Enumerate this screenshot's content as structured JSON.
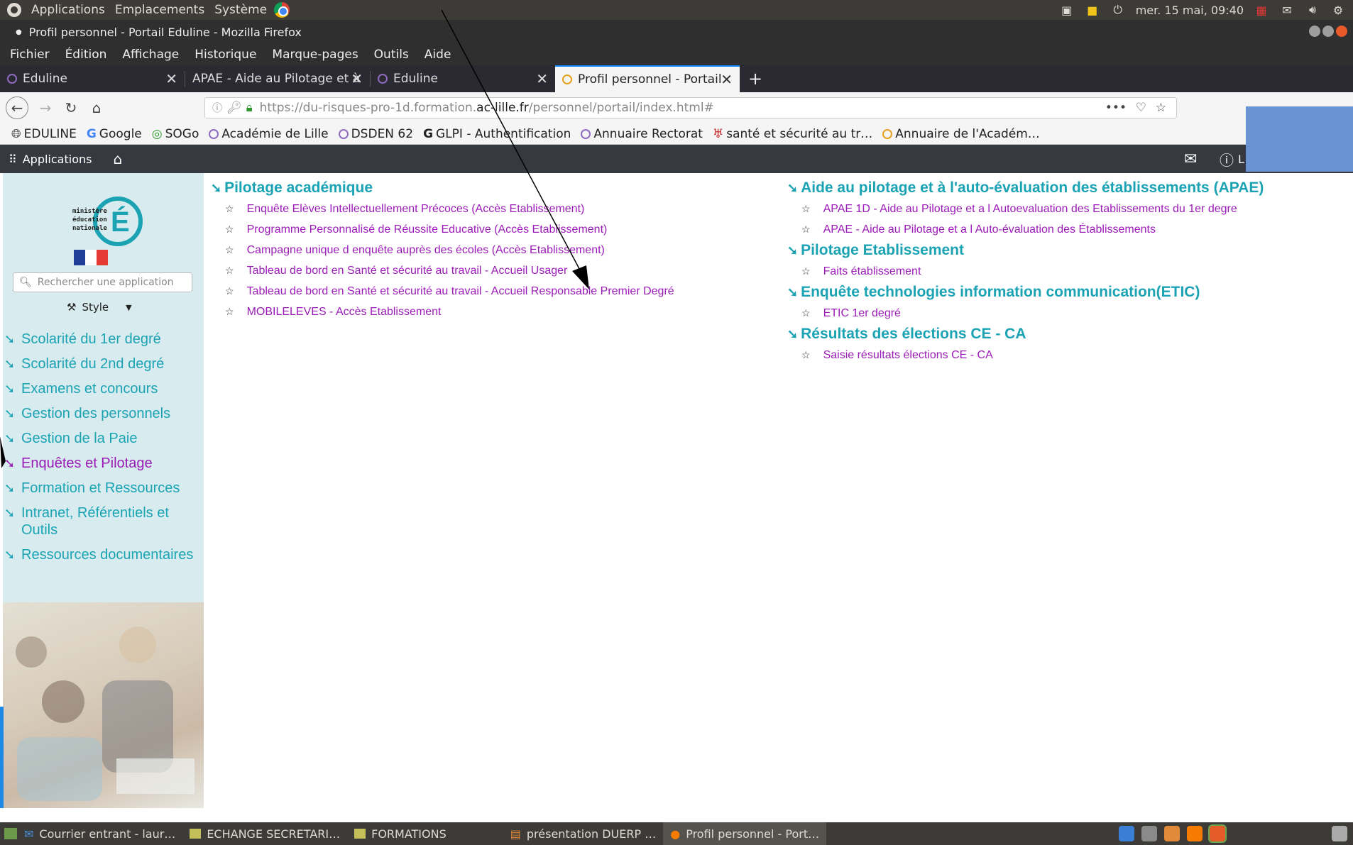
{
  "top_panel": {
    "applications": "Applications",
    "emplacements": "Emplacements",
    "systeme": "Système",
    "clock": "mer. 15 mai, 09:40"
  },
  "window": {
    "title": "Profil personnel - Portail Eduline - Mozilla Firefox"
  },
  "menu": [
    "Fichier",
    "Édition",
    "Affichage",
    "Historique",
    "Marque-pages",
    "Outils",
    "Aide"
  ],
  "tabs": [
    {
      "label": "Eduline",
      "active": false
    },
    {
      "label": "APAE - Aide au Pilotage et à",
      "active": false
    },
    {
      "label": "Eduline",
      "active": false
    },
    {
      "label": "Profil personnel - Portail",
      "active": true
    }
  ],
  "url": {
    "prefix": "https://du-risques-pro-1d.formation.",
    "domain": "ac-lille.fr",
    "path": "/personnel/portail/index.html#"
  },
  "bookmarks": [
    "EDULINE",
    "Google",
    "SOGo",
    "Académie de Lille",
    "DSDEN 62",
    "GLPI - Authentification",
    "Annuaire Rectorat",
    "santé et sécurité au tr…",
    "Annuaire de l'Académ…"
  ],
  "app_header": {
    "applications_label": "Applications",
    "user_initial": "L"
  },
  "sidebar": {
    "logo_lines": [
      "ministère",
      "éducation",
      "nationale"
    ],
    "search_placeholder": "Rechercher une application",
    "style_label": "Style",
    "nav": [
      {
        "label": "Scolarité du 1er degré",
        "active": false
      },
      {
        "label": "Scolarité du 2nd degré",
        "active": false
      },
      {
        "label": "Examens et concours",
        "active": false
      },
      {
        "label": "Gestion des personnels",
        "active": false
      },
      {
        "label": "Gestion de la Paie",
        "active": false
      },
      {
        "label": "Enquêtes et Pilotage",
        "active": true
      },
      {
        "label": "Formation et Ressources",
        "active": false
      },
      {
        "label": "Intranet, Référentiels et Outils",
        "active": false
      },
      {
        "label": "Ressources documentaires",
        "active": false
      }
    ]
  },
  "sections": [
    {
      "title": "Pilotage académique",
      "links": [
        "Enquête Elèves Intellectuellement Précoces (Accès Etablissement)",
        "Programme Personnalisé de Réussite Educative (Accès Etablissement)",
        "Campagne unique d enquête auprès des écoles (Accès Etablissement)",
        "Tableau de bord en Santé et sécurité au travail - Accueil Usager",
        "Tableau de bord en Santé et sécurité au travail - Accueil Responsable Premier Degré",
        "MOBILELEVES - Accès Etablissement"
      ]
    },
    {
      "title": "Aide au pilotage et à l'auto-évaluation des établissements (APAE)",
      "links": [
        "APAE 1D - Aide au Pilotage et a l Autoevaluation des Etablissements du 1er degre",
        "APAE - Aide au Pilotage et a l Auto-évaluation des Établissements"
      ]
    },
    {
      "title": "Pilotage Etablissement",
      "links": [
        "Faits établissement"
      ]
    },
    {
      "title": "Enquête technologies information communication(ETIC)",
      "links": [
        "ETIC 1er degré"
      ]
    },
    {
      "title": "Résultats des élections CE - CA",
      "links": [
        "Saisie résultats élections CE - CA"
      ]
    }
  ],
  "taskbar": [
    {
      "label": "Courrier entrant - laur…",
      "active": false
    },
    {
      "label": "ECHANGE SECRETARI…",
      "active": false
    },
    {
      "label": "FORMATIONS",
      "active": false
    },
    {
      "label": "présentation DUERP …",
      "active": false
    },
    {
      "label": "Profil personnel - Port…",
      "active": true
    }
  ],
  "colors": {
    "section_title": "#1ba3b4",
    "link": "#9b1bb7",
    "sidebar_bg": "#d8ecef",
    "header_bg": "#363a40"
  }
}
